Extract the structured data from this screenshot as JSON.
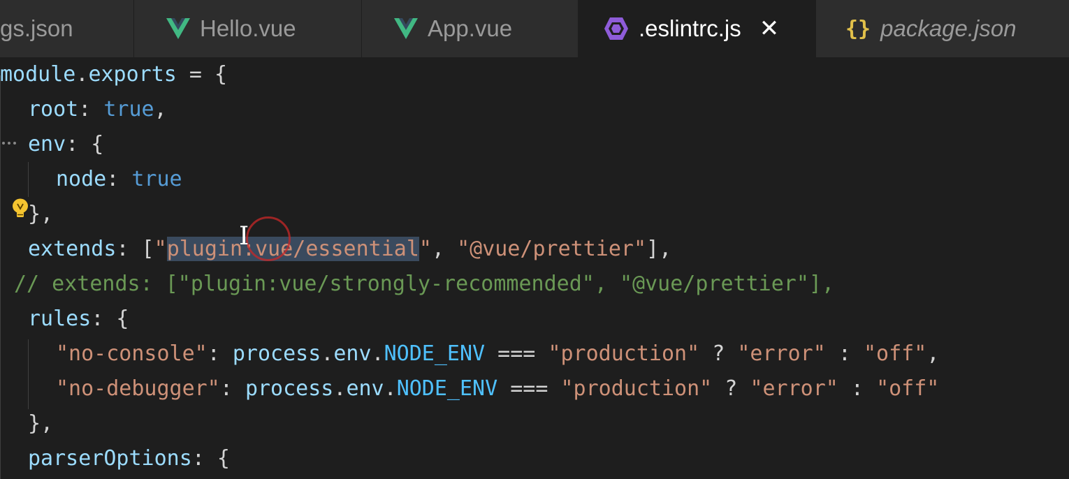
{
  "tabs": [
    {
      "label": "gs.json",
      "icon": "json-icon",
      "active": false,
      "italic": false
    },
    {
      "label": "Hello.vue",
      "icon": "vue-icon",
      "active": false,
      "italic": false
    },
    {
      "label": "App.vue",
      "icon": "vue-icon",
      "active": false,
      "italic": false
    },
    {
      "label": ".eslintrc.js",
      "icon": "eslint-icon",
      "active": true,
      "italic": false,
      "close": "✕"
    },
    {
      "label": "package.json",
      "icon": "json-icon",
      "active": false,
      "italic": true,
      "icon_text": "{}"
    }
  ],
  "code": {
    "l1_a": "module",
    "l1_b": ".",
    "l1_c": "exports",
    "l1_d": " = {",
    "l2_a": "root",
    "l2_b": ": ",
    "l2_c": "true",
    "l2_d": ",",
    "l3_a": "env",
    "l3_b": ": {",
    "l4_a": "node",
    "l4_b": ": ",
    "l4_c": "true",
    "l5": "},",
    "l6_a": "extends",
    "l6_b": ": [",
    "l6_c": "\"",
    "l6_d": "plugin:vue/essential",
    "l6_e": "\"",
    "l6_f": ", ",
    "l6_g": "\"@vue/prettier\"",
    "l6_h": "],",
    "l7": "// extends: [\"plugin:vue/strongly-recommended\", \"@vue/prettier\"],",
    "l8_a": "rules",
    "l8_b": ": {",
    "l9_a": "\"no-console\"",
    "l9_b": ": ",
    "l9_c": "process",
    "l9_d": ".",
    "l9_e": "env",
    "l9_f": ".",
    "l9_g": "NODE_ENV",
    "l9_h": " === ",
    "l9_i": "\"production\"",
    "l9_j": " ? ",
    "l9_k": "\"error\"",
    "l9_l": " : ",
    "l9_m": "\"off\"",
    "l9_n": ",",
    "l10_a": "\"no-debugger\"",
    "l10_b": ": ",
    "l10_c": "process",
    "l10_d": ".",
    "l10_e": "env",
    "l10_f": ".",
    "l10_g": "NODE_ENV",
    "l10_h": " === ",
    "l10_i": "\"production\"",
    "l10_j": " ? ",
    "l10_k": "\"error\"",
    "l10_l": " : ",
    "l10_m": "\"off\"",
    "l11": "},",
    "l12_a": "parserOptions",
    "l12_b": ": {"
  },
  "colors": {
    "editor_bg": "#1e1e1e",
    "tab_bg": "#2d2d2d",
    "vue_green": "#41b883",
    "eslint_purple": "#8e5cd9",
    "json_yellow": "#e2c14a"
  }
}
